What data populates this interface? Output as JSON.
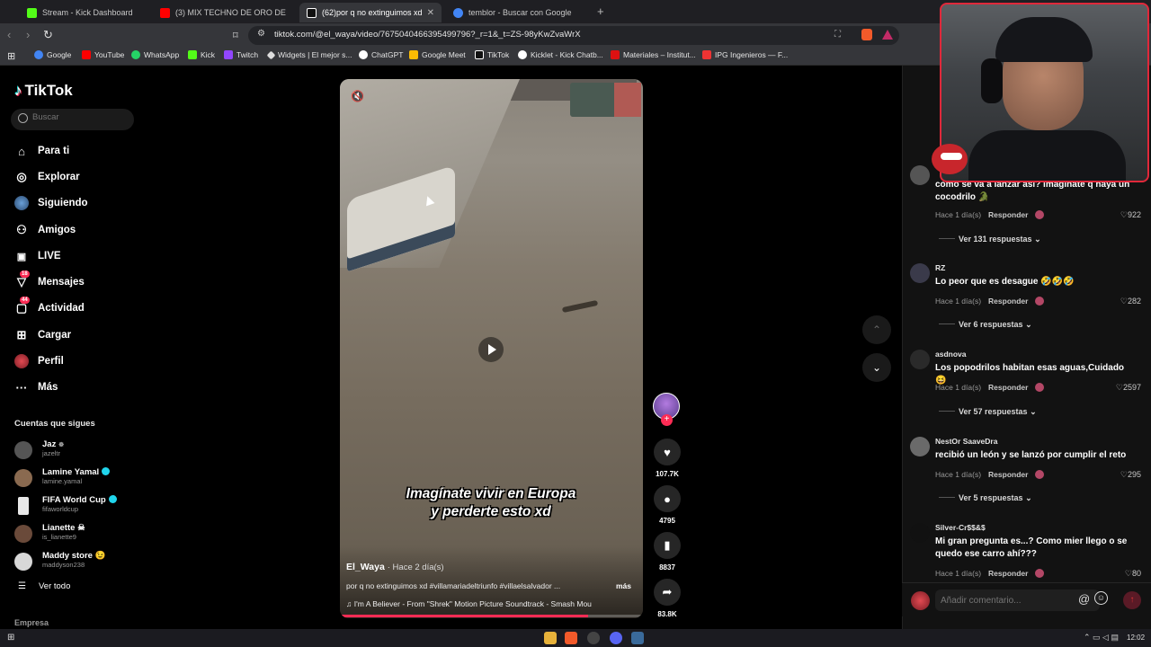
{
  "browser": {
    "tabs": [
      {
        "label": "Stream - Kick Dashboard",
        "color": "#53fc18"
      },
      {
        "label": "(3) MIX TECHNO DE ORO DE 80's &",
        "color": "#ff0000"
      },
      {
        "label": "(62)por q no extinguimos xd #vill",
        "color": "#ffffff"
      },
      {
        "label": "temblor - Buscar con Google",
        "color": "#4285f4"
      }
    ],
    "url": "tiktok.com/@el_waya/video/7675040466395499796?_r=1&_t=ZS-98yKwZvaWrX"
  },
  "bookmarks": [
    {
      "label": "Google",
      "color": "#4285f4"
    },
    {
      "label": "YouTube",
      "color": "#ff0000"
    },
    {
      "label": "WhatsApp",
      "color": "#25d366"
    },
    {
      "label": "Kick",
      "color": "#53fc18"
    },
    {
      "label": "Twitch",
      "color": "#9146ff"
    },
    {
      "label": "Widgets | El mejor s...",
      "color": "#dddddd"
    },
    {
      "label": "ChatGPT",
      "color": "#ffffff"
    },
    {
      "label": "Google Meet",
      "color": "#fbbc04"
    },
    {
      "label": "TikTok",
      "color": "#ffffff"
    },
    {
      "label": "Kicklet - Kick Chatb...",
      "color": "#ffffff"
    },
    {
      "label": "Materiales – Institut...",
      "color": "#d11"
    },
    {
      "label": "IPG Ingenieros — F...",
      "color": "#e33"
    }
  ],
  "sidebar": {
    "logo": "TikTok",
    "search_placeholder": "Buscar",
    "nav": [
      {
        "label": "Para ti",
        "icon": "home"
      },
      {
        "label": "Explorar",
        "icon": "compass"
      },
      {
        "label": "Siguiendo",
        "icon": "avatar"
      },
      {
        "label": "Amigos",
        "icon": "friends"
      },
      {
        "label": "LIVE",
        "icon": "live"
      },
      {
        "label": "Mensajes",
        "icon": "messages",
        "badge": "18"
      },
      {
        "label": "Actividad",
        "icon": "activity",
        "badge": "44"
      },
      {
        "label": "Cargar",
        "icon": "upload"
      },
      {
        "label": "Perfil",
        "icon": "profile"
      },
      {
        "label": "Más",
        "icon": "more"
      }
    ],
    "following_title": "Cuentas que sigues",
    "accounts": [
      {
        "name": "Jaz",
        "handle": "jazeltr",
        "verified": false,
        "suffix": "☸",
        "color": "#555"
      },
      {
        "name": "Lamine Yamal",
        "handle": "lamine.yamal",
        "verified": true,
        "suffix": "",
        "color": "#8a6a50"
      },
      {
        "name": "FIFA World Cup",
        "handle": "fifaworldcup",
        "verified": true,
        "suffix": "",
        "color": "#e8e8e8"
      },
      {
        "name": "Lianette",
        "handle": "is_lianette9",
        "verified": false,
        "suffix": "☠",
        "color": "#6a4a3a"
      },
      {
        "name": "Maddy store",
        "handle": "maddyson238",
        "verified": false,
        "suffix": "😉",
        "color": "#d8d8d8"
      }
    ],
    "see_all": "Ver todo",
    "company": "Empresa"
  },
  "video": {
    "caption": "Imagínate vivir en Europa\ny perderte esto xd",
    "author": "El_Waya",
    "posted": "Hace 2 día(s)",
    "description": "por q no extinguimos xd #villamariadeltriunfo #villaelsalvador ...",
    "more": "más",
    "music": "♫  I'm A Believer - From \"Shrek\" Motion Picture Soundtrack - Smash Mou",
    "progress": 0.82
  },
  "actions": {
    "likes": "107.7K",
    "comments": "4795",
    "saves": "8837",
    "shares": "83.8K"
  },
  "comments": [
    {
      "user": "",
      "text": "como se va a lanzar así? imagínate q haya un cocodrilo 🐊",
      "time": "Hace 1 día(s)",
      "reply": "Responder",
      "likes": "922",
      "replies": "Ver 131 respuestas",
      "avatar": "#555"
    },
    {
      "user": "RZ",
      "text": "Lo peor que es desague 🤣🤣🤣",
      "time": "Hace 1 día(s)",
      "reply": "Responder",
      "likes": "282",
      "replies": "Ver 6 respuestas",
      "avatar": "#3a3a4a"
    },
    {
      "user": "asdnova",
      "text": "Los popodrilos habitan esas aguas,Cuidado😆",
      "time": "Hace 1 día(s)",
      "reply": "Responder",
      "likes": "2597",
      "replies": "Ver 57 respuestas",
      "avatar": "#2a2a2a"
    },
    {
      "user": "NestOr SaaveDra",
      "text": "recibió un león y se lanzó por cumplir el reto",
      "time": "Hace 1 día(s)",
      "reply": "Responder",
      "likes": "295",
      "replies": "Ver 5 respuestas",
      "avatar": "#6a6a6a"
    },
    {
      "user": "Silver-Cr$$&$",
      "text": "Mi gran pregunta es...? Como mier llego o se quedo ese carro ahí???",
      "time": "Hace 1 día(s)",
      "reply": "Responder",
      "likes": "80",
      "replies": "",
      "avatar": "#111"
    }
  ],
  "comment_box": {
    "placeholder": "Añadir comentario..."
  },
  "taskbar": {
    "clock": "12:02"
  }
}
